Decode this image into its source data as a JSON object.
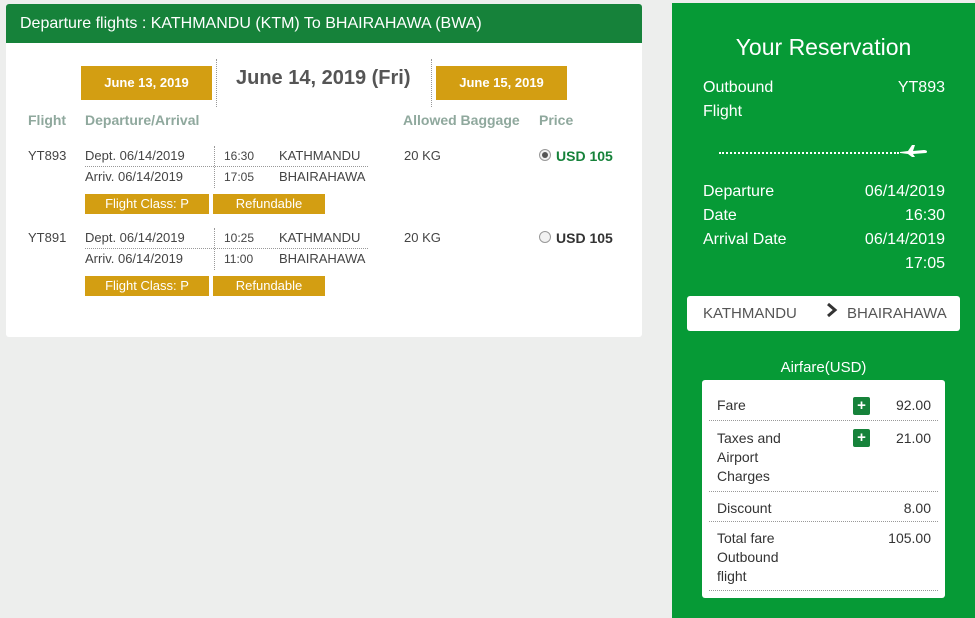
{
  "header": {
    "title": "Departure flights : KATHMANDU (KTM) To BHAIRAHAWA (BWA)"
  },
  "date_nav": {
    "prev": "June 13, 2019",
    "current": "June 14, 2019 (Fri)",
    "next": "June 15, 2019"
  },
  "columns": {
    "flight": "Flight",
    "departure_arrival": "Departure/Arrival",
    "baggage": "Allowed Baggage",
    "price": "Price"
  },
  "flights": [
    {
      "flight_no": "YT893",
      "dept": "Dept. 06/14/2019",
      "arriv": "Arriv. 06/14/2019",
      "dept_time": "16:30",
      "arr_time": "17:05",
      "from": "KATHMANDU",
      "to": "BHAIRAHAWA",
      "baggage": "20 KG",
      "price": "USD 105",
      "selected": true,
      "flight_class": "Flight Class: P",
      "refund": "Refundable"
    },
    {
      "flight_no": "YT891",
      "dept": "Dept. 06/14/2019",
      "arriv": "Arriv. 06/14/2019",
      "dept_time": "10:25",
      "arr_time": "11:00",
      "from": "KATHMANDU",
      "to": "BHAIRAHAWA",
      "baggage": "20 KG",
      "price": "USD 105",
      "selected": false,
      "flight_class": "Flight Class: P",
      "refund": "Refundable"
    }
  ],
  "reservation": {
    "title": "Your Reservation",
    "outbound_label_1": "Outbound",
    "outbound_label_2": "Flight",
    "outbound_flight": "YT893",
    "departure_label_1": "Departure",
    "departure_label_2": "Date",
    "departure_date": "06/14/2019",
    "departure_time": "16:30",
    "arrival_label": "Arrival Date",
    "arrival_date": "06/14/2019",
    "arrival_time": "17:05",
    "route_from": "KATHMANDU",
    "route_to": "BHAIRAHAWA",
    "airfare_title": "Airfare(USD)",
    "fare": {
      "fare_label": "Fare",
      "fare_value": "92.00",
      "taxes_label_1": "Taxes and",
      "taxes_label_2": "Airport",
      "taxes_label_3": "Charges",
      "taxes_value": "21.00",
      "discount_label": "Discount",
      "discount_value": "8.00",
      "total_label_1": "Total fare",
      "total_label_2": "Outbound",
      "total_label_3": "flight",
      "total_value": "105.00"
    }
  },
  "colors": {
    "header_green": "#16823a",
    "panel_green": "#069a36",
    "gold": "#d39e12"
  }
}
